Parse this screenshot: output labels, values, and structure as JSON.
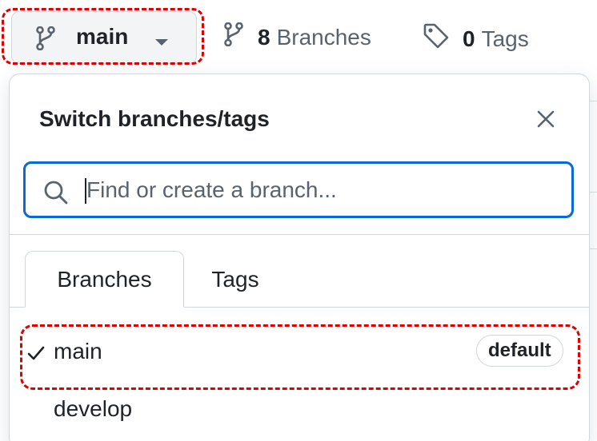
{
  "top_bar": {
    "branch_button": {
      "label": "main",
      "icon": "git-branch-icon",
      "caret_icon": "triangle-down-icon"
    },
    "branches_link": {
      "count": "8",
      "label": "Branches",
      "icon": "git-branch-icon"
    },
    "tags_link": {
      "count": "0",
      "label": "Tags",
      "icon": "tag-icon"
    }
  },
  "popover": {
    "title": "Switch branches/tags",
    "close_icon": "x-icon",
    "search": {
      "placeholder": "Find or create a branch...",
      "value": "",
      "icon": "search-icon"
    },
    "tabs": [
      {
        "label": "Branches",
        "selected": true
      },
      {
        "label": "Tags",
        "selected": false
      }
    ],
    "branches": [
      {
        "name": "main",
        "selected": true,
        "badge": "default"
      },
      {
        "name": "develop",
        "selected": false
      }
    ]
  },
  "colors": {
    "accent": "#0969da",
    "annotation_highlight": "#e00000",
    "text": "#1f2328",
    "muted_text": "#59636e",
    "border": "#d0d7de"
  }
}
